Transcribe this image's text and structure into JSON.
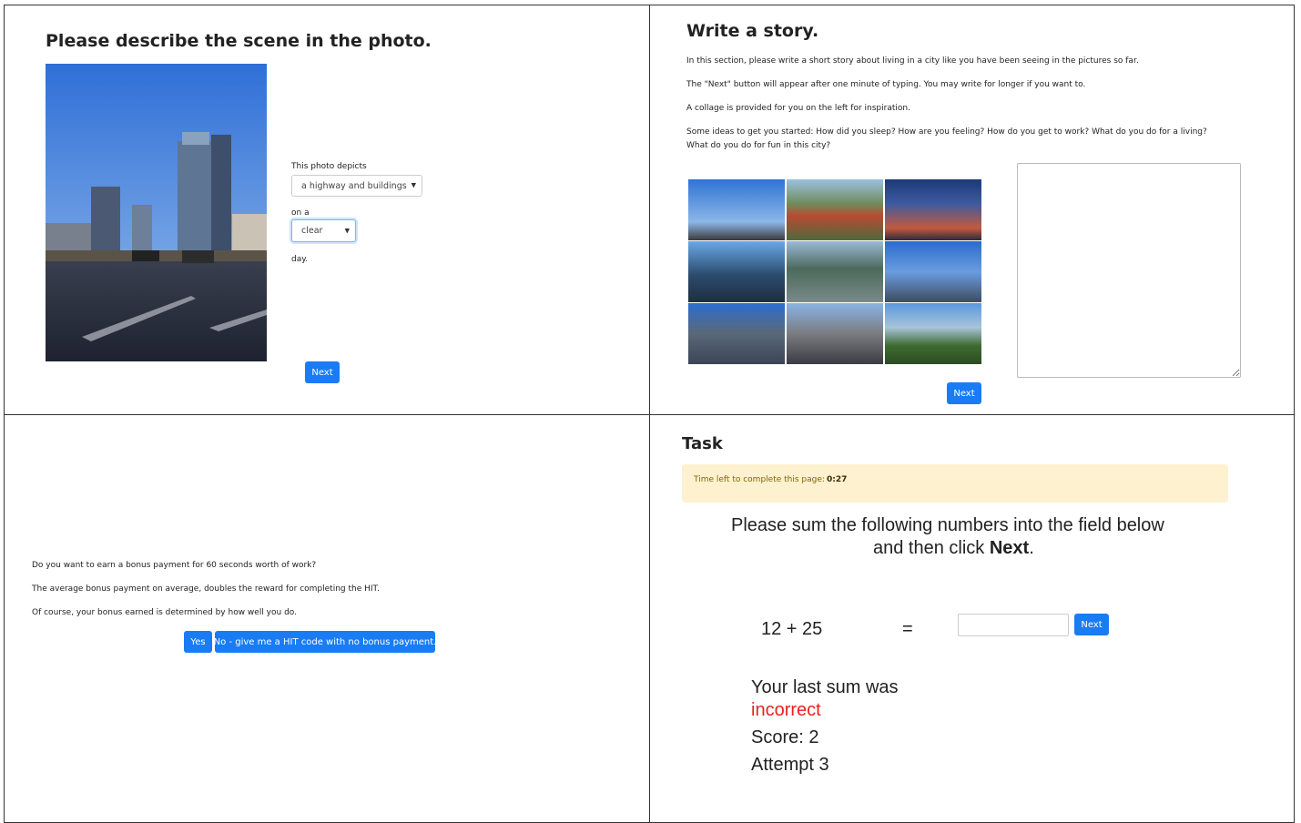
{
  "panel1": {
    "title": "Please describe the scene in the photo.",
    "label_depicts": "This photo depicts",
    "select_scene": "a highway and buildings",
    "label_on": "on a",
    "select_weather": "clear",
    "label_day": "day.",
    "next_label": "Next"
  },
  "panel2": {
    "title": "Write a story.",
    "para1": "In this section, please write a short story about living in a city like you have been seeing in the pictures so far.",
    "para2": "The \"Next\" button will appear after one minute of typing. You may write for longer if you want to.",
    "para3": "A collage is provided for you on the left for inspiration.",
    "para4_line1": "Some ideas to get you started: How did you sleep? How are you feeling? How do you get to work? What do you do for a living?",
    "para4_line2": "What do you do for fun in this city?",
    "story_value": "",
    "next_label": "Next"
  },
  "panel3": {
    "line1": "Do you want to earn a bonus payment for 60 seconds worth of work?",
    "line2": "The average bonus payment on average, doubles the reward for completing the HIT.",
    "line3": "Of course, your bonus earned is determined by how well you do.",
    "yes_label": "Yes",
    "no_label": "No - give me a HIT code with no bonus payment."
  },
  "panel4": {
    "title": "Task",
    "timer_prefix": "Time left to complete this page: ",
    "timer_value": "0:27",
    "instr_line1": "Please sum the following numbers into the field below",
    "instr_line2_pre": "and then click ",
    "instr_line2_bold": "Next",
    "instr_line2_post": ".",
    "equation": "12 + 25",
    "equals": "=",
    "answer_value": "",
    "next_label": "Next",
    "last_sum_label": "Your last sum was",
    "last_sum_result": "incorrect",
    "score": "Score: 2",
    "attempt": "Attempt 3"
  },
  "colors": {
    "button": "#1a7cf5",
    "alert_bg": "#fdf1cf",
    "alert_text": "#856404",
    "incorrect": "#e8211a"
  }
}
